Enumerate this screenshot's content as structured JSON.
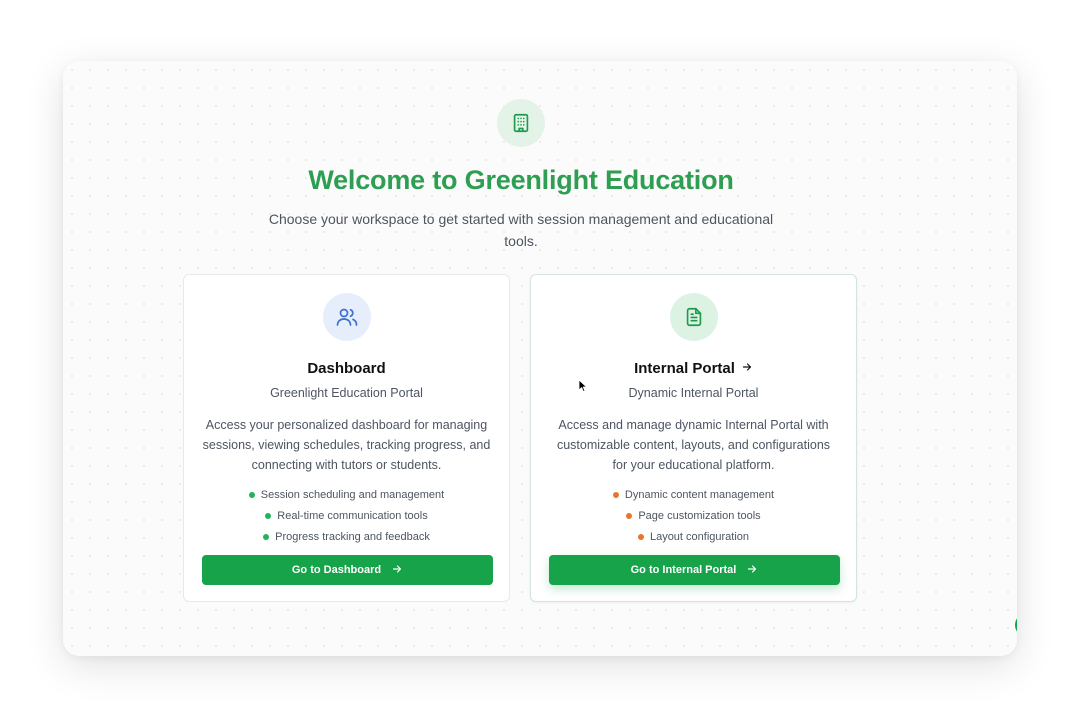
{
  "header": {
    "title": "Welcome to Greenlight Education",
    "subtitle": "Choose your workspace to get started with session management and educational tools."
  },
  "icons": {
    "hero": "building-icon",
    "dashboard": "users-icon",
    "portal": "document-icon",
    "arrow": "arrow-right-icon"
  },
  "cards": [
    {
      "title": "Dashboard",
      "subtitle": "Greenlight Education Portal",
      "description": "Access your personalized dashboard for managing sessions, viewing schedules, tracking progress, and connecting with tutors or students.",
      "features": [
        "Session scheduling and management",
        "Real-time communication tools",
        "Progress tracking and feedback"
      ],
      "button_label": "Go to Dashboard"
    },
    {
      "title": "Internal Portal",
      "subtitle": "Dynamic Internal Portal",
      "description": "Access and manage dynamic Internal Portal with customizable content, layouts, and configurations for your educational platform.",
      "features": [
        "Dynamic content management",
        "Page customization tools",
        "Layout configuration"
      ],
      "button_label": "Go to Internal Portal"
    }
  ],
  "colors": {
    "brand_green": "#2e9e52",
    "button_green": "#16a34a",
    "feature_dot_dashboard": "#1fb35a",
    "feature_dot_portal": "#e8762a",
    "icon_blue": "#3b6fd4"
  }
}
